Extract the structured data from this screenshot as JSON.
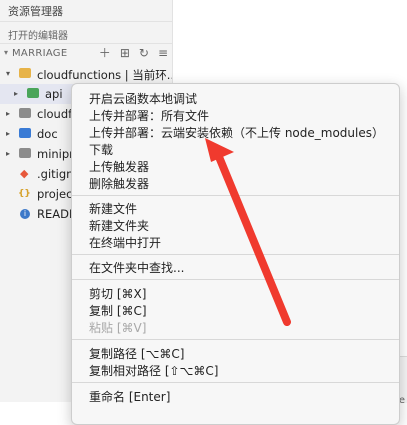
{
  "explorer": {
    "title": "资源管理器",
    "open_editors": "打开的编辑器",
    "project": "MARRIAGE",
    "tree": [
      {
        "label": "cloudfunctions | 当前环...",
        "twisty": "▾",
        "icon": "folder-yellow"
      },
      {
        "label": "api",
        "twisty": "▸",
        "icon": "folder-green"
      },
      {
        "label": "cloudfu",
        "twisty": "▸",
        "icon": "folder-gray"
      },
      {
        "label": "doc",
        "twisty": "▸",
        "icon": "folder-blue"
      },
      {
        "label": "minipro",
        "twisty": "▸",
        "icon": "folder-gray"
      },
      {
        "label": ".gitigno",
        "icon": "file-git"
      },
      {
        "label": "project",
        "icon": "file-json"
      },
      {
        "label": "READM",
        "icon": "file-info"
      }
    ]
  },
  "menu": {
    "items": [
      {
        "label": "开启云函数本地调试",
        "disabled": false
      },
      {
        "label": "上传并部署：所有文件",
        "disabled": false
      },
      {
        "label": "上传并部署：云端安装依赖（不上传 node_modules）",
        "disabled": false
      },
      {
        "label": "下载",
        "disabled": false
      },
      {
        "label": "上传触发器",
        "disabled": false
      },
      {
        "label": "删除触发器",
        "disabled": false
      },
      {
        "label": "新建文件",
        "disabled": false
      },
      {
        "label": "新建文件夹",
        "disabled": false
      },
      {
        "label": "在终端中打开",
        "disabled": false
      },
      {
        "label": "在文件夹中查找...",
        "disabled": false
      },
      {
        "label": "剪切 [⌘X]",
        "disabled": false
      },
      {
        "label": "复制 [⌘C]",
        "disabled": false
      },
      {
        "label": "粘贴 [⌘V]",
        "disabled": true
      },
      {
        "label": "复制路径 [⌥⌘C]",
        "disabled": false
      },
      {
        "label": "复制相对路径 [⇧⌥⌘C]",
        "disabled": false
      },
      {
        "label": "重命名 [Enter]",
        "disabled": false
      }
    ]
  },
  "bottom_hint": "Se",
  "annotation_arrow": {
    "color": "#f03a2e"
  }
}
